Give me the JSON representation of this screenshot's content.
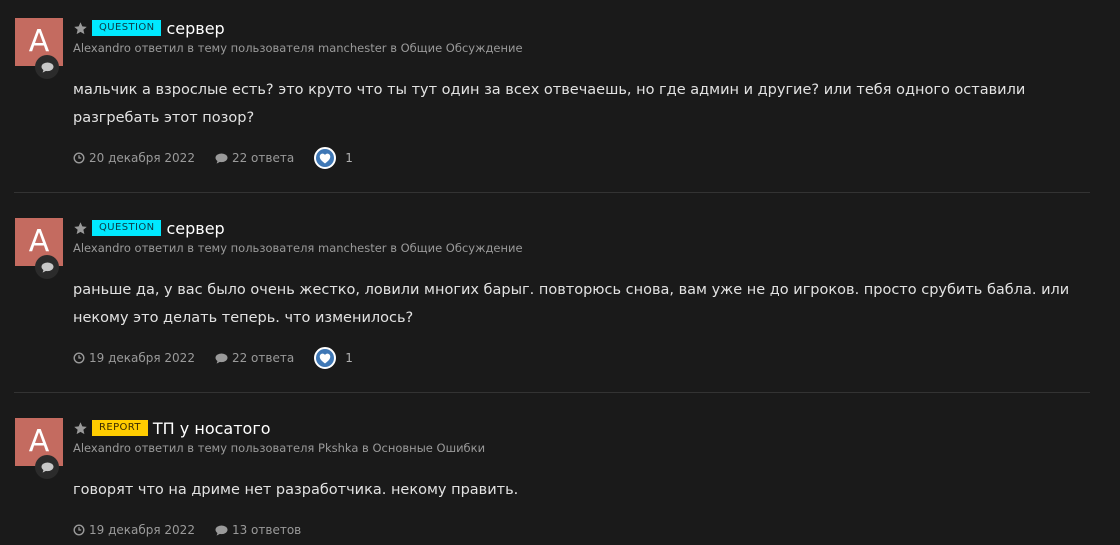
{
  "entries": [
    {
      "avatar_letter": "A",
      "prefix": "QUESTION",
      "title": "сервер",
      "meta": "Alexandro ответил в тему пользователя manchester в Общие Обсуждение",
      "body": "мальчик а взрослые есть? это круто что ты тут один за всех отвечаешь, но где админ и другие? или тебя одного оставили разгребать этот позор?",
      "date": "20 декабря 2022",
      "replies": "22 ответа",
      "reaction_count": "1"
    },
    {
      "avatar_letter": "A",
      "prefix": "QUESTION",
      "title": "сервер",
      "meta": "Alexandro ответил в тему пользователя manchester в Общие Обсуждение",
      "body": "раньше да, у вас было очень жестко, ловили многих барыг. повторюсь снова, вам уже не до игроков. просто срубить бабла. или некому это делать теперь. что изменилось?",
      "date": "19 декабря 2022",
      "replies": "22 ответа",
      "reaction_count": "1"
    },
    {
      "avatar_letter": "A",
      "prefix": "REPORT",
      "title": "ТП у носатого",
      "meta": "Alexandro ответил в тему пользователя Pkshka в Основные Ошибки",
      "body": "говорят что на дриме нет разработчика. некому править.",
      "date": "19 декабря 2022",
      "replies": "13 ответов"
    }
  ],
  "colors": {
    "background": "#1a1a1a",
    "avatar": "#c46b60",
    "question_prefix": "#00e8ff",
    "report_prefix": "#ffcc00",
    "reaction": "#3f78b6"
  },
  "icons": {
    "star": "star-icon",
    "comment": "comment-icon",
    "clock": "clock-icon",
    "heart": "heart-icon"
  }
}
